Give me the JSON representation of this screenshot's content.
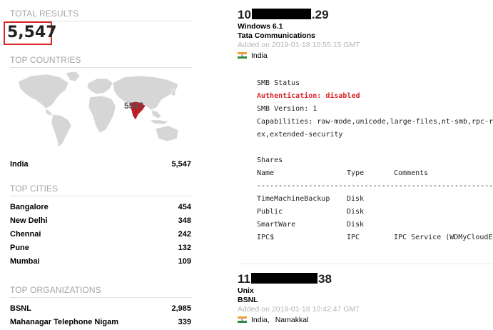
{
  "left": {
    "total_results": {
      "heading": "TOTAL RESULTS",
      "value": "5,547"
    },
    "top_countries": {
      "heading": "TOP COUNTRIES",
      "map_label": "5547",
      "items": [
        {
          "name": "India",
          "count": "5,547"
        }
      ]
    },
    "top_cities": {
      "heading": "TOP CITIES",
      "items": [
        {
          "name": "Bangalore",
          "count": "454"
        },
        {
          "name": "New Delhi",
          "count": "348"
        },
        {
          "name": "Chennai",
          "count": "242"
        },
        {
          "name": "Pune",
          "count": "132"
        },
        {
          "name": "Mumbai",
          "count": "109"
        }
      ]
    },
    "top_organizations": {
      "heading": "TOP ORGANIZATIONS",
      "items": [
        {
          "name": "BSNL",
          "count": "2,985"
        },
        {
          "name": "Mahanagar Telephone Nigam",
          "count": "339"
        }
      ]
    }
  },
  "results": [
    {
      "ip_prefix": "10",
      "ip_suffix": ".29",
      "os": "Windows 6.1",
      "isp": "Tata Communications",
      "added": "Added on 2019-01-18 10:55:15 GMT",
      "country": "India",
      "city": "",
      "banner": {
        "status_title": "SMB Status",
        "auth": "Authentication: disabled",
        "version": "SMB Version: 1",
        "capabilities_1": "Capabilities: raw-mode,unicode,large-files,nt-smb,rpc-re",
        "capabilities_2": "ex,extended-security",
        "shares_title": "Shares",
        "col_name": "Name",
        "col_type": "Type",
        "col_comments": "Comments",
        "rule": "-----------------------------------------------------------",
        "shares": [
          {
            "name": "TimeMachineBackup",
            "type": "Disk",
            "comment": ""
          },
          {
            "name": "Public",
            "type": "Disk",
            "comment": ""
          },
          {
            "name": "SmartWare",
            "type": "Disk",
            "comment": ""
          },
          {
            "name": "IPC$",
            "type": "IPC",
            "comment": "IPC Service (WDMyCloudEX"
          }
        ]
      }
    },
    {
      "ip_prefix": "11",
      "ip_suffix": "38",
      "os": "Unix",
      "isp": "BSNL",
      "added": "Added on 2019-01-18 10:42:47 GMT",
      "country": "India,",
      "city": "Namakkal"
    }
  ],
  "colors": {
    "accent": "#d9262b",
    "muted": "#a6a6a6",
    "map_land": "#d6d6d6",
    "map_highlight": "#b81f27"
  }
}
